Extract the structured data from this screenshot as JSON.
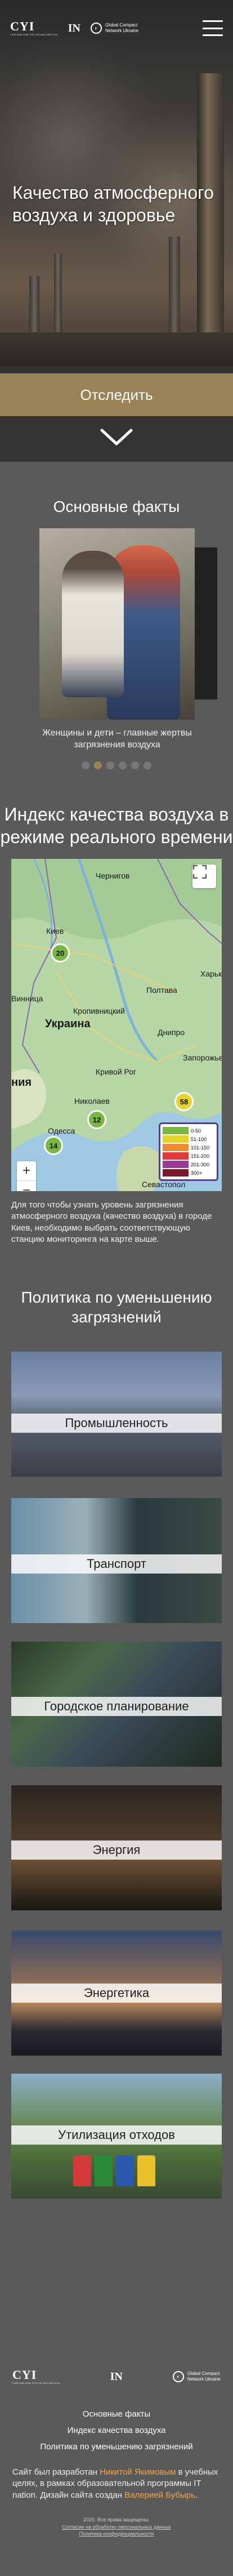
{
  "header": {
    "logo_main": "CYI",
    "logo_sub": "CENTER FOR YOUTH INITIATIVES",
    "logo_in": "IN",
    "gc_line1": "Global Compact",
    "gc_line2": "Network Ukraine"
  },
  "hero": {
    "title": "Качество атмосферного воздуха и здоровье",
    "button": "Отследить"
  },
  "facts": {
    "title": "Основные факты",
    "caption": "Женщины и дети – главные жертвы загрязнения воздуха",
    "dots": 6,
    "active_dot": 1
  },
  "aqi": {
    "title": "Индекс качества воздуха в режиме реального времени",
    "labels": {
      "kyiv": "Киев",
      "chernihiv": "Чернигов",
      "kharkiv": "Харьк",
      "poltava": "Полтава",
      "dnipro": "Днипро",
      "zaporizhzhia": "Запорожье",
      "ukraine": "Украина",
      "kryvyi_rih": "Кривой Рог",
      "mykolaiv": "Николаев",
      "odesa": "Одесса",
      "sevastopol": "Севастопол",
      "vinnytsia": "Винница",
      "kropyvnytskyi": "Кропивницкий",
      "moldova": "ния"
    },
    "markers": [
      {
        "label": "20",
        "color": "green"
      },
      {
        "label": "12",
        "color": "green"
      },
      {
        "label": "58",
        "color": "yellow"
      },
      {
        "label": "14",
        "color": "green"
      }
    ],
    "legend": [
      {
        "range": "0-50",
        "color": "#79b83f"
      },
      {
        "range": "51-100",
        "color": "#e6d22a"
      },
      {
        "range": "101-150",
        "color": "#f08a2a"
      },
      {
        "range": "151-200",
        "color": "#e03a3a"
      },
      {
        "range": "201-300",
        "color": "#9a3a9a"
      },
      {
        "range": "300+",
        "color": "#7a1a2a"
      }
    ],
    "zoom_in": "+",
    "zoom_out": "−",
    "description": "Для того чтобы узнать уровень загрязнения атмосферного воздуха (качество воздуха) в городе Киев, необходимо выбрать соответствующую станцию мониторинга на карте выше."
  },
  "policy": {
    "title": "Политика по уменьшению загрязнений",
    "cards": [
      "Промышленность",
      "Транспорт",
      "Городское планирование",
      "Энергия",
      "Энергетика",
      "Утилизация отходов"
    ]
  },
  "footer": {
    "nav": [
      "Основные факты",
      "Индекс качества воздуха",
      "Политика по уменьшению загрязнений"
    ],
    "credit_prefix": "Сайт был разработан",
    "credit_author": "Никитой Якимовым",
    "credit_mid": "в учебных целях, в рамках образовательной программы IT nation. Дизайн сайта создан",
    "credit_designer": "Валерией Бубырь",
    "credit_suffix": ".",
    "copy_line1": "2020. Все права защищены.",
    "copy_line2": "Согласие на обработку персональных данных",
    "copy_line3": "Политика конфиденциальности"
  }
}
